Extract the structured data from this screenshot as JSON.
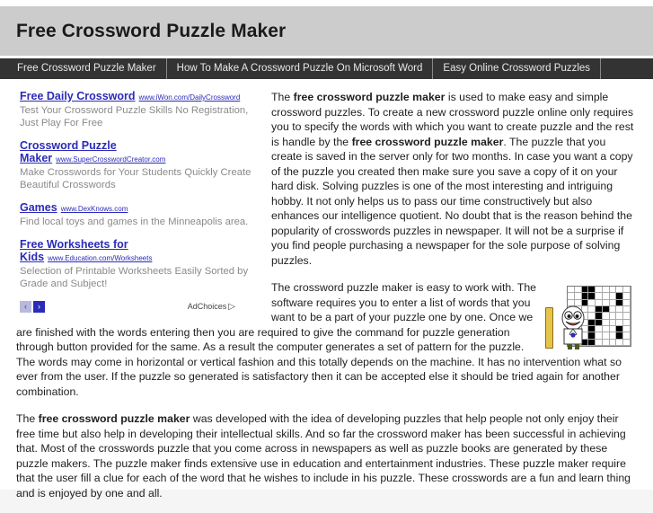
{
  "header": {
    "site_title": "Free Crossword Puzzle Maker",
    "bg_color": "#cccccc"
  },
  "nav": {
    "bg_color": "#333333",
    "items": [
      {
        "label": "Free Crossword Puzzle Maker"
      },
      {
        "label": "How To Make A Crossword Puzzle On Microsoft Word"
      },
      {
        "label": "Easy Online Crossword Puzzles"
      }
    ]
  },
  "ads": {
    "link_color": "#2b2bb8",
    "units": [
      {
        "title": "Free Daily Crossword",
        "url": "www.iWon.com/DailyCrossword",
        "description": "Test Your Crossword Puzzle Skills No Registration, Just Play For Free"
      },
      {
        "title": "Crossword Puzzle Maker",
        "url": "www.SuperCrosswordCreator.com",
        "description": "Make Crosswords for Your Students Quickly Create Beautiful Crosswords"
      },
      {
        "title": "Games",
        "url": "www.DexKnows.com",
        "description": "Find local toys and games in the Minneapolis area."
      },
      {
        "title": "Free Worksheets for Kids",
        "url": "www.Education.com/Worksheets",
        "description": "Selection of Printable Worksheets Easily Sorted by Grade and Subject!"
      }
    ],
    "prev_label": "‹",
    "next_label": "›",
    "adchoices_label": "AdChoices",
    "adchoices_icon": "▷"
  },
  "article": {
    "paragraph1_prefix": "The ",
    "paragraph1_bold1": "free crossword puzzle maker",
    "paragraph1_mid": " is used to make easy and simple crossword puzzles. To create a new crossword puzzle online only requires you to specify the words with which you want to create puzzle and the rest is handle by the ",
    "paragraph1_bold2": "free crossword puzzle maker",
    "paragraph1_suffix": ". The puzzle that you create is saved in the server only for two months. In case you want a copy of the puzzle you created then make sure you save a copy of it on your hard disk. Solving puzzles is one of the most interesting and intriguing hobby. It not only helps us to pass our time constructively but also enhances our intelligence quotient. No doubt that is the reason behind the popularity of crosswords puzzles in newspaper. It will not be a surprise if you find people purchasing a newspaper for the sole purpose of solving puzzles.",
    "paragraph2": "The crossword puzzle maker is easy to work with. The software requires you to enter a list of words that you want to be a part of your puzzle one by one. Once we are finished with the words entering then you are required to give the command for puzzle generation through button provided for the same. As a result the computer generates a set of pattern for the puzzle. The words may come in horizontal or vertical fashion and this totally depends on the machine. It has no intervention what so ever from the user. If the puzzle so generated is satisfactory then it can be accepted else it should be tried again for another combination.",
    "paragraph3_prefix": "The ",
    "paragraph3_bold": "free crossword puzzle maker",
    "paragraph3_suffix": " was developed with the idea of developing puzzles that help people not only enjoy their free time but also help in developing their intellectual skills. And so far the crossword maker has been successful in achieving that. Most of the crosswords puzzle that you come across in newspapers as well as puzzle books are generated by these puzzle makers. The puzzle maker finds extensive use in education and entertainment industries. These puzzle maker require that the user fill a clue for each of the word that he wishes to include in his puzzle. These crosswords are a fun and learn thing and is enjoyed by one and all."
  },
  "crossword_image": {
    "alt": "crossword-puzzle-mascot-illustration",
    "blocked_cells": [
      2,
      3,
      11,
      12,
      16,
      20,
      25,
      31,
      32,
      40,
      48,
      49,
      57,
      61,
      66,
      70,
      74,
      75
    ]
  }
}
